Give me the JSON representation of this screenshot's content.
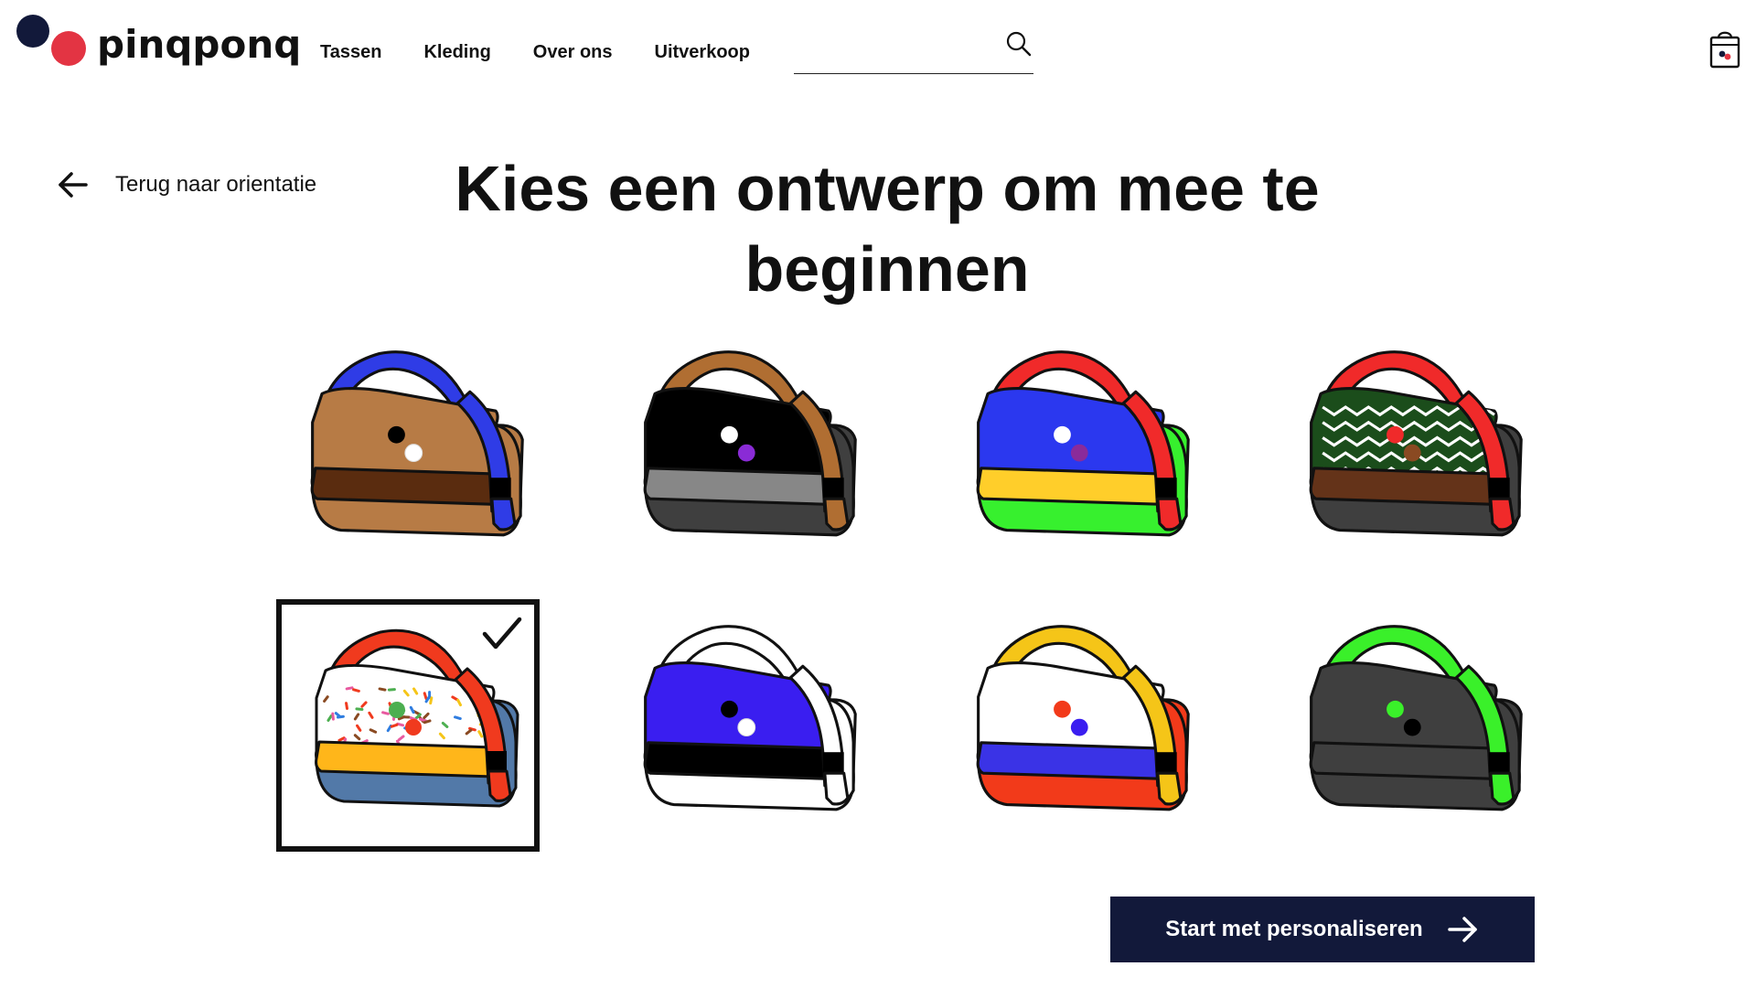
{
  "brand": {
    "name": "pinqponq",
    "colors": {
      "navy": "#12193a",
      "red": "#e33443"
    }
  },
  "nav": {
    "items": [
      {
        "label": "Tassen"
      },
      {
        "label": "Kleding"
      },
      {
        "label": "Over ons"
      },
      {
        "label": "Uitverkoop"
      }
    ]
  },
  "search": {
    "value": "",
    "placeholder": "",
    "icon": "search-icon"
  },
  "cart": {
    "icon": "shopping-bag-icon"
  },
  "back": {
    "label": "Terug naar orientatie",
    "icon": "arrow-left-icon"
  },
  "page": {
    "title": "Kies een ontwerp om mee te beginnen"
  },
  "designs": [
    {
      "strap": "#2f3ce6",
      "flap": "#b77b45",
      "band": "#5a2c0f",
      "body": "#b77b45",
      "side": "#b77b45",
      "dot1": "#000000",
      "dot2": "#ffffff",
      "pattern": "none",
      "selected": false
    },
    {
      "strap": "#b06e32",
      "flap": "#000000",
      "band": "#878787",
      "body": "#3f3f3f",
      "side": "#3f3f3f",
      "dot1": "#ffffff",
      "dot2": "#8a2bd6",
      "pattern": "none",
      "selected": false
    },
    {
      "strap": "#f02a2a",
      "flap": "#2b38ef",
      "band": "#ffce2a",
      "body": "#37f02e",
      "side": "#37f02e",
      "dot1": "#ffffff",
      "dot2": "#8a2b9a",
      "pattern": "none",
      "selected": false
    },
    {
      "strap": "#f02a2a",
      "flap": "#1b4d1b",
      "band": "#643319",
      "body": "#3f3f3f",
      "side": "#3f3f3f",
      "dot1": "#f02a2a",
      "dot2": "#8a4a22",
      "pattern": "zigzag",
      "selected": false
    },
    {
      "strap": "#f03a1e",
      "flap": "#ffffff",
      "band": "#ffb61a",
      "body": "#5279a8",
      "side": "#5279a8",
      "dot1": "#4caf50",
      "dot2": "#f03a1e",
      "pattern": "sprinkles",
      "selected": true
    },
    {
      "strap": "#ffffff",
      "flap": "#3a1ef0",
      "band": "#000000",
      "body": "#ffffff",
      "side": "#ffffff",
      "dot1": "#000000",
      "dot2": "#ffffff",
      "pattern": "none",
      "selected": false
    },
    {
      "strap": "#f5c518",
      "flap": "#ffffff",
      "band": "#3a33e6",
      "body": "#f23a1a",
      "side": "#f23a1a",
      "dot1": "#f23a1a",
      "dot2": "#3a1ef0",
      "pattern": "none",
      "selected": false
    },
    {
      "strap": "#3af02a",
      "flap": "#3f3f3f",
      "band": "#3f3f3f",
      "body": "#3f3f3f",
      "side": "#3f3f3f",
      "dot1": "#3af02a",
      "dot2": "#000000",
      "pattern": "none",
      "selected": false
    }
  ],
  "cta": {
    "label": "Start met personaliseren",
    "icon": "arrow-right-icon"
  }
}
